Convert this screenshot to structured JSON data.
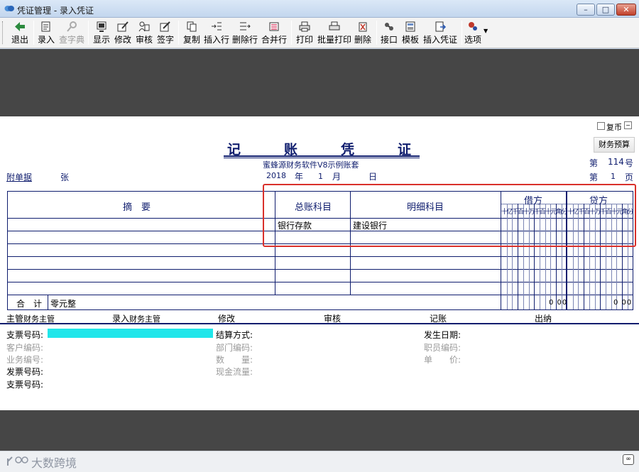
{
  "window": {
    "title": "凭证管理 - 录入凭证",
    "controls": {
      "minimize": "–",
      "maximize": "□",
      "close": "✕"
    }
  },
  "toolbar": [
    {
      "label": "退出",
      "icon": "exit-arrow-icon",
      "enabled": true
    },
    {
      "label": "录入",
      "icon": "new-entry-icon",
      "enabled": true
    },
    {
      "label": "查字典",
      "icon": "dictionary-search-icon",
      "enabled": false
    },
    {
      "label": "显示",
      "icon": "display-icon",
      "enabled": true
    },
    {
      "label": "修改",
      "icon": "edit-icon",
      "enabled": true
    },
    {
      "label": "审核",
      "icon": "audit-icon",
      "enabled": true
    },
    {
      "label": "签字",
      "icon": "sign-icon",
      "enabled": true
    },
    {
      "label": "复制",
      "icon": "copy-icon",
      "enabled": true
    },
    {
      "label": "插入行",
      "icon": "insert-row-icon",
      "enabled": true
    },
    {
      "label": "删除行",
      "icon": "delete-row-icon",
      "enabled": true
    },
    {
      "label": "合并行",
      "icon": "merge-row-icon",
      "enabled": true
    },
    {
      "label": "打印",
      "icon": "printer-icon",
      "enabled": true
    },
    {
      "label": "批量打印",
      "icon": "batch-print-icon",
      "enabled": true
    },
    {
      "label": "删除",
      "icon": "delete-icon",
      "enabled": true
    },
    {
      "label": "接口",
      "icon": "interface-icon",
      "enabled": true
    },
    {
      "label": "模板",
      "icon": "template-icon",
      "enabled": true
    },
    {
      "label": "插入凭证",
      "icon": "insert-voucher-icon",
      "enabled": true
    },
    {
      "label": "选项",
      "icon": "options-icon",
      "enabled": true
    }
  ],
  "voucher": {
    "foreign_currency_label": "复币",
    "budget_button": "财务预算",
    "title_chars": [
      "记",
      "账",
      "凭",
      "证"
    ],
    "company": "蜜蜂源财务软件V8示例账套",
    "attachment_label": "附单据",
    "attachment_unit": "张",
    "year": "2018",
    "year_label": "年",
    "month": "1",
    "month_label": "月",
    "day_label": "日",
    "number_prefix": "第",
    "number": "114",
    "number_suffix": "号",
    "page_prefix": "第",
    "page": "1",
    "page_suffix": "页"
  },
  "table": {
    "headers": {
      "summary": "摘　要",
      "general_account": "总账科目",
      "detail_account": "明细科目",
      "debit": "借方",
      "credit": "贷方"
    },
    "digit_headers": [
      "十",
      "亿",
      "千",
      "百",
      "十",
      "万",
      "千",
      "百",
      "十",
      "元",
      "角",
      "分"
    ],
    "rows": [
      {
        "summary": "",
        "general": "银行存款",
        "detail": "建设银行"
      },
      {
        "summary": "",
        "general": "",
        "detail": ""
      },
      {
        "summary": "",
        "general": "",
        "detail": ""
      },
      {
        "summary": "",
        "general": "",
        "detail": ""
      },
      {
        "summary": "",
        "general": "",
        "detail": ""
      },
      {
        "summary": "",
        "general": "",
        "detail": ""
      }
    ],
    "total_label": "合　计",
    "total_words": "零元整",
    "debit_total": "0 00",
    "credit_total": "0 00"
  },
  "signatures": [
    {
      "label": "主管",
      "value": "财务主管"
    },
    {
      "label": "录入",
      "value": "财务主管"
    },
    {
      "label": "修改",
      "value": ""
    },
    {
      "label": "审核",
      "value": ""
    },
    {
      "label": "记账",
      "value": ""
    },
    {
      "label": "出纳",
      "value": ""
    }
  ],
  "details": {
    "cheque_no": "支票号码:",
    "settlement": "结算方式:",
    "occur_date": "发生日期:",
    "customer_code": "客户编码:",
    "dept_code": "部门编码:",
    "staff_code": "职员编码:",
    "business_code": "业务编号:",
    "quantity": "数　　量:",
    "unit_price": "单　　价:",
    "invoice_no": "发票号码:",
    "cash_flow": "现金流量:",
    "cheque_no2": "支票号码:"
  },
  "watermark": "大数跨境",
  "colors": {
    "accent": "#0f1d6e",
    "highlight": "#20e6ea",
    "annotation": "#d9302b"
  }
}
